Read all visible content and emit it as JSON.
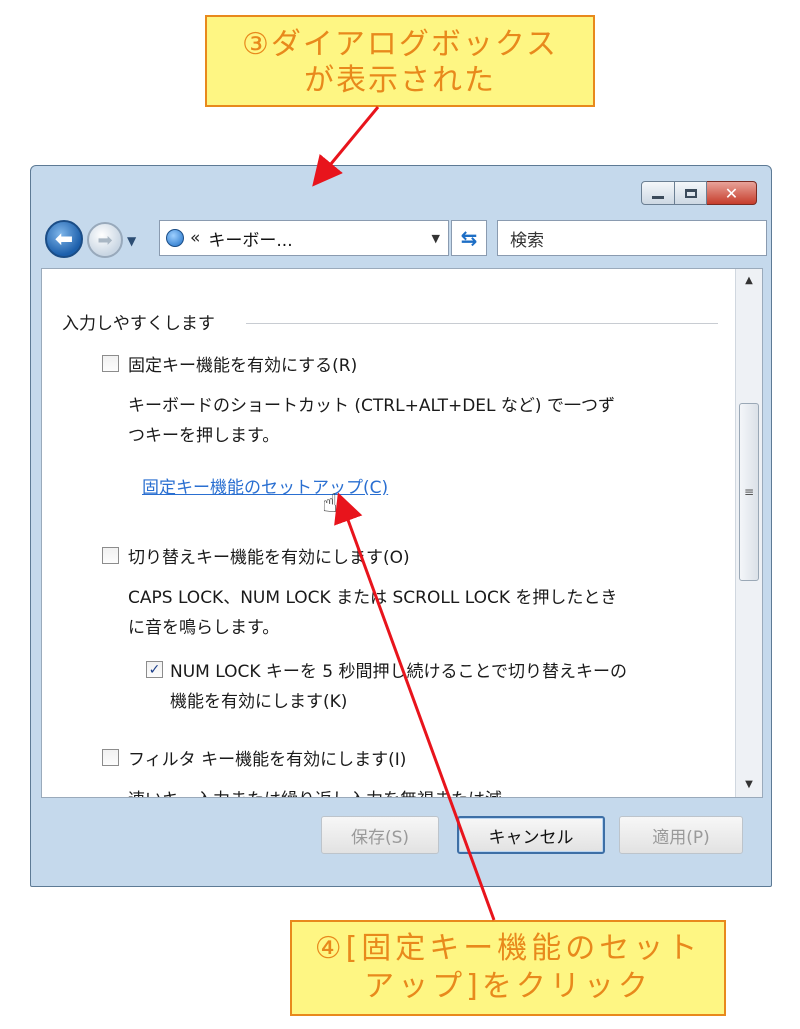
{
  "callouts": {
    "top": {
      "line1": "③ダイアログボックス",
      "line2": "が表示された"
    },
    "bottom": {
      "line1": "④[固定キー機能のセット",
      "line2": "アップ]をクリック"
    }
  },
  "nav": {
    "address": "キーボー...",
    "address_sep": "«",
    "search_placeholder": "検索"
  },
  "content": {
    "group_label": "入力しやすくします",
    "sticky_keys": {
      "label": "固定キー機能を有効にする(R)",
      "checked": false,
      "desc_line1": "キーボードのショートカット (CTRL+ALT+DEL など) で一つず",
      "desc_line2": "つキーを押します。",
      "setup_link": "固定キー機能のセットアップ(C)"
    },
    "toggle_keys": {
      "label": "切り替えキー機能を有効にします(O)",
      "checked": false,
      "desc_line1": "CAPS LOCK、NUM LOCK または SCROLL LOCK を押したとき",
      "desc_line2": "に音を鳴らします。",
      "sub_label_line1": "NUM LOCK キーを 5 秒間押し続けることで切り替えキーの",
      "sub_label_line2": "機能を有効にします(K)",
      "sub_checked": true
    },
    "filter_keys": {
      "label": "フィルタ キー機能を有効にします(I)",
      "checked": false,
      "desc_partial": "速いキー入力または繰り返し入力を無視または減"
    }
  },
  "buttons": {
    "save": "保存(S)",
    "cancel": "キャンセル",
    "apply": "適用(P)"
  },
  "colors": {
    "callout_bg": "#fef683",
    "callout_text": "#e8891c",
    "arrow": "#e8141c",
    "link": "#2a6fd1"
  }
}
